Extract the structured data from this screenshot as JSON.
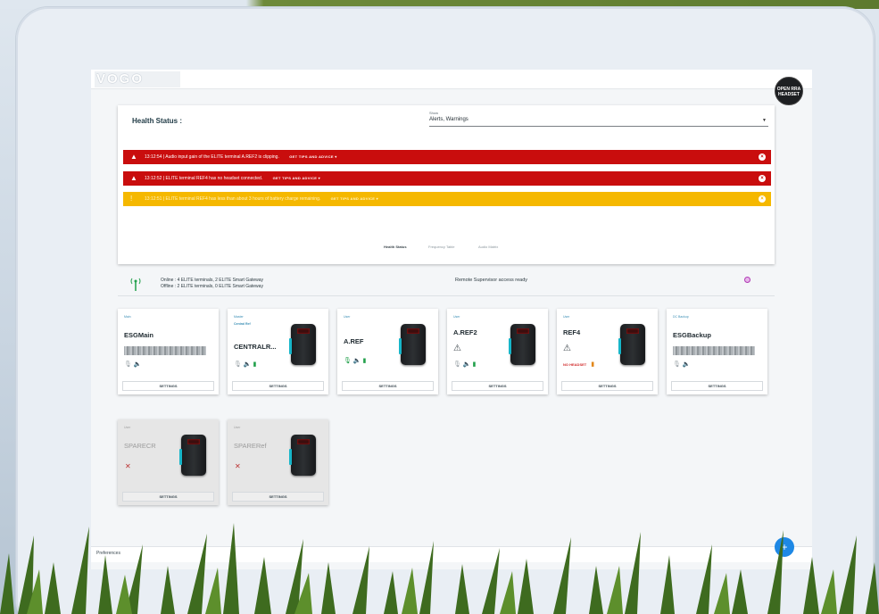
{
  "app": {
    "logo_text": "VOGO",
    "open_headset_label": "OPEN RRA HEADSET"
  },
  "health": {
    "title": "Health Status :",
    "show_label": "Show",
    "show_value": "Alerts, Warnings",
    "alerts": [
      {
        "level": "error",
        "text": "13:12:54 | Audio input gain of the ELITE terminal A.REF2 is clipping.",
        "tips": "GET TIPS AND ADVICE ▾"
      },
      {
        "level": "error",
        "text": "13:12:52 | ELITE terminal REF4 has no headset connected.",
        "tips": "GET TIPS AND ADVICE ▾"
      },
      {
        "level": "warning",
        "text": "13:12:51 | ELITE terminal REF4 has less than about 3 hours of battery charge remaining.",
        "tips": "GET TIPS AND ADVICE ▾"
      }
    ],
    "tabs": [
      "Health Status",
      "Frequency Table",
      "Audio Matrix"
    ]
  },
  "status": {
    "online": "Online : 4 ELITE terminals, 2 ELITE Smart Gateway",
    "offline": "Offline : 2 ELITE terminals, 0 ELITE Smart Gateway",
    "remote": "Remote Supervisor access ready"
  },
  "devices": [
    {
      "role": "Main",
      "sub": "",
      "name": "ESGMain",
      "settings": "SETTINGS"
    },
    {
      "role": "Master",
      "sub": "Central Ref",
      "name": "CENTRALR...",
      "settings": "SETTINGS"
    },
    {
      "role": "User",
      "sub": "",
      "name": "A.REF",
      "settings": "SETTINGS"
    },
    {
      "role": "User",
      "sub": "",
      "name": "A.REF2",
      "settings": "SETTINGS"
    },
    {
      "role": "User",
      "sub": "",
      "name": "REF4",
      "no_headset": "NO HEADSET",
      "settings": "SETTINGS"
    },
    {
      "role": "DC Backup",
      "sub": "",
      "name": "ESGBackup",
      "settings": "SETTINGS"
    },
    {
      "role": "User",
      "sub": "",
      "name": "SPARECR",
      "settings": "SETTINGS"
    },
    {
      "role": "User",
      "sub": "",
      "name": "SPARERef",
      "settings": "SETTINGS"
    }
  ],
  "footer": {
    "text": "Preferences",
    "fab": "+"
  },
  "colors": {
    "error": "#c90d0d",
    "warning": "#f5b800",
    "online": "#22a04b",
    "fab": "#1e88e5"
  }
}
